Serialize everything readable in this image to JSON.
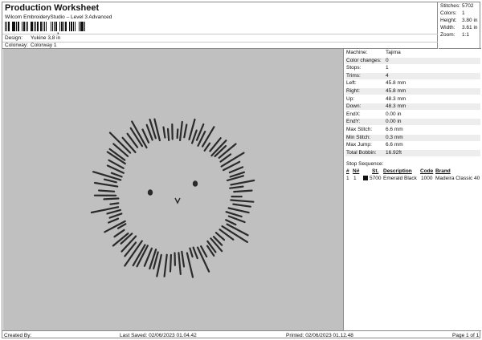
{
  "header": {
    "title": "Production Worksheet",
    "subtitle": "Wilcom EmbroideryStudio – Level 3 Advanced",
    "barcode_comma": ",",
    "design_label": "Design:",
    "design_value": "Yukine 3,8 in",
    "colorway_label": "Colorway:",
    "colorway_value": "Colorway 1"
  },
  "stats": [
    {
      "label": "Stitches:",
      "value": "5702"
    },
    {
      "label": "Colors:",
      "value": "1"
    },
    {
      "label": "Height:",
      "value": "3.80 in"
    },
    {
      "label": "Width:",
      "value": "3.61 in"
    },
    {
      "label": "Zoom:",
      "value": "1:1"
    }
  ],
  "machine_info": [
    {
      "label": "Machine:",
      "value": "Tajima"
    },
    {
      "label": "Color changes:",
      "value": "0"
    },
    {
      "label": "Stops:",
      "value": "1"
    },
    {
      "label": "Trims:",
      "value": "4"
    },
    {
      "label": "Left:",
      "value": "45.8 mm"
    },
    {
      "label": "Right:",
      "value": "45.8 mm"
    },
    {
      "label": "Up:",
      "value": "48.3 mm"
    },
    {
      "label": "Down:",
      "value": "48.3 mm"
    },
    {
      "label": "EndX:",
      "value": "0.00 in"
    },
    {
      "label": "EndY:",
      "value": "0.00 in"
    },
    {
      "label": "Max Stitch:",
      "value": "6.6 mm"
    },
    {
      "label": "Min Stitch:",
      "value": "0.3 mm"
    },
    {
      "label": "Max Jump:",
      "value": "6.6 mm"
    },
    {
      "label": "Total Bobbin:",
      "value": "16.92ft"
    }
  ],
  "stop_sequence": {
    "title": "Stop Sequence:",
    "headers": [
      "#",
      "N#",
      "St.",
      "Description",
      "Code",
      "Brand"
    ],
    "rows": [
      {
        "num": "1",
        "n": "1",
        "st": "5700",
        "description": "Emerald Black",
        "code": "1000",
        "brand": "Madeira Classic 40",
        "color": "#111111"
      }
    ]
  },
  "footer": {
    "created_by": "Created By:",
    "last_saved": "Last Saved: 02/06/2023 01.04.42",
    "printed": "Printed: 02/06/2023 01.12.48",
    "page": "Page 1 of 1"
  },
  "design_colors": {
    "background": "#c0c0c0",
    "thread": "#2a2a2a"
  }
}
